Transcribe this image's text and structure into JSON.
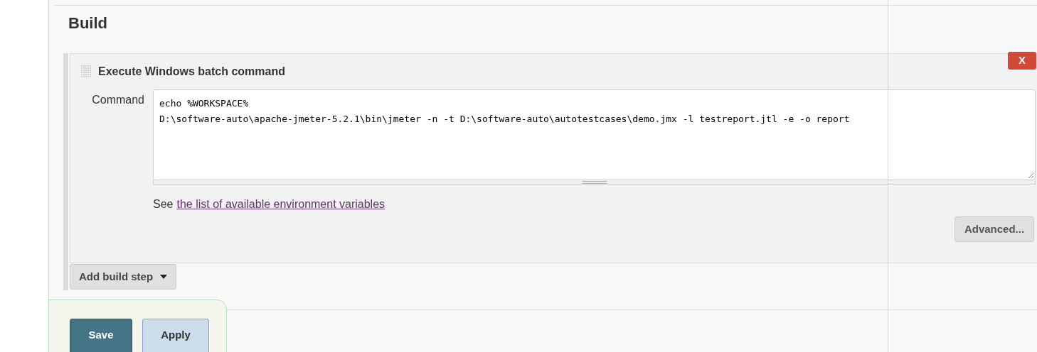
{
  "section": {
    "title": "Build"
  },
  "build_step": {
    "title": "Execute Windows batch command",
    "delete_label": "X",
    "field_label": "Command",
    "command_lines": [
      "echo %WORKSPACE%",
      "D:\\software-auto\\apache-jmeter-5.2.1\\bin\\jmeter -n -t D:\\software-auto\\autotestcases\\demo.jmx -l testreport.jtl -e -o report"
    ],
    "help_prefix": "See",
    "help_link": "the list of available environment variables",
    "advanced_label": "Advanced..."
  },
  "add_step_label": "Add build step",
  "buttons": [
    {
      "label": "Save",
      "kind": "primary"
    },
    {
      "label": "Apply",
      "kind": "secondary"
    }
  ]
}
